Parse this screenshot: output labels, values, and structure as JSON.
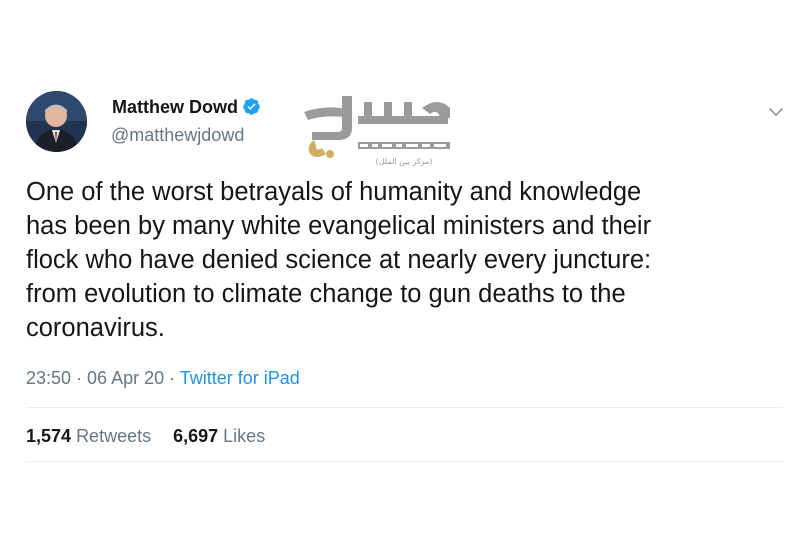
{
  "user": {
    "display_name": "Matthew Dowd",
    "handle": "@matthewjdowd",
    "verified": true
  },
  "tweet": {
    "lines": [
      "One of the worst betrayals of humanity and knowledge",
      "has been by many white evangelical ministers and their",
      "flock who have denied science at nearly every juncture:",
      "from evolution to climate change to gun deaths to the",
      "coronavirus."
    ],
    "time": "23:50",
    "date": "06 Apr 20",
    "source": "Twitter for iPad",
    "separator": " · "
  },
  "stats": {
    "retweets_count": "1,574",
    "retweets_label": "Retweets",
    "likes_count": "6,697",
    "likes_label": "Likes"
  },
  "watermark": {
    "line1": "سراج",
    "line2": "(مرکز بین الملل)"
  },
  "colors": {
    "text_primary": "#14171a",
    "text_secondary": "#657786",
    "link_blue": "#1b95e0",
    "verified_blue": "#1da1f2",
    "divider": "#e6ecf0",
    "watermark_gold": "#c8a24a",
    "watermark_gray": "#8a8a8a"
  },
  "icons": {
    "verified": "verified-badge-icon",
    "chevron": "chevron-down-icon"
  }
}
